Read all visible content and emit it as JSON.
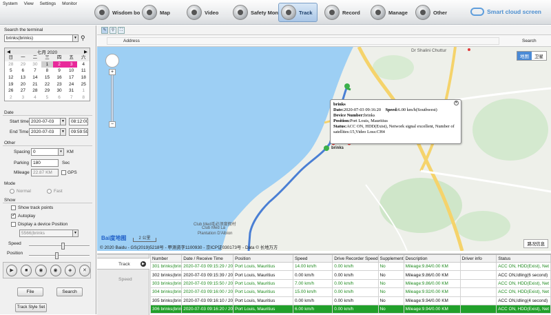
{
  "menu": [
    "System",
    "View",
    "Settings",
    "Monitor"
  ],
  "nav": [
    {
      "label": "Wisdom bo",
      "icon": "dashboard-icon"
    },
    {
      "label": "Map",
      "icon": "map-icon"
    },
    {
      "label": "Video",
      "icon": "video-icon"
    },
    {
      "label": "Safety Mon",
      "icon": "safety-icon"
    },
    {
      "label": "Track",
      "icon": "track-icon",
      "active": true
    },
    {
      "label": "Record",
      "icon": "record-icon"
    },
    {
      "label": "Manage",
      "icon": "manage-icon"
    },
    {
      "label": "Other",
      "icon": "other-icon"
    }
  ],
  "brand": "Smart cloud screen",
  "left": {
    "search_label": "Search the terminal",
    "terminal": "brinks(brinks)",
    "calendar": {
      "month": "七月 2020",
      "weekdays": [
        "日",
        "一",
        "二",
        "三",
        "四",
        "五",
        "六"
      ],
      "days": [
        [
          "28",
          "29",
          "30",
          "1",
          "2",
          "3",
          "4"
        ],
        [
          "5",
          "6",
          "7",
          "8",
          "9",
          "10",
          "11"
        ],
        [
          "12",
          "13",
          "14",
          "15",
          "16",
          "17",
          "18"
        ],
        [
          "19",
          "20",
          "21",
          "22",
          "23",
          "24",
          "25"
        ],
        [
          "26",
          "27",
          "28",
          "29",
          "30",
          "31",
          "1"
        ],
        [
          "2",
          "3",
          "4",
          "5",
          "6",
          "7",
          "8"
        ]
      ]
    },
    "date_label": "Date",
    "start_time_label": "Start time",
    "start_date": "2020-07-03",
    "start_time": "08:12:00",
    "end_time_label": "End Time",
    "end_date": "2020-07-03",
    "end_time": "09:59:59",
    "other_label": "Other",
    "spacing_label": "Spacing",
    "spacing_value": "0",
    "spacing_unit": "KM",
    "parking_label": "Parking",
    "parking_value": "180",
    "parking_unit": "Sec",
    "mileage_label": "Mileage",
    "mileage_value": "22.87 KM",
    "gps_label": "GPS",
    "mode_label": "Mode",
    "mode_normal": "Normal",
    "mode_fast": "Fast",
    "show_label": "Show",
    "show_track_points": "Show track points",
    "autoplay": "Autoplay",
    "display_device": "Display a device Position",
    "device_select": "5566(brinks",
    "speed_label": "Speed",
    "position_label": "Position",
    "file_btn": "File",
    "search_btn": "Search",
    "track_style_btn": "Track Style Set"
  },
  "map": {
    "address_label": "Address",
    "search_btn": "Search",
    "type_map": "地图",
    "type_sat": "卫星",
    "place_label": "Dr Shalini Chuttur",
    "resort_label_cn": "Club Med毛必须度假村",
    "resort_label_1": "Club Med La",
    "resort_label_2": "Plantation D'Albion",
    "marker_label": "brinks",
    "scale_label": "2 公里",
    "copyright": "© 2020 Baidu - GS(2019)5218号 - 甲测资字1100930 - 京ICP证030173号 - Data © 长地万方",
    "road_info": "路况信息",
    "popup": {
      "title": "brinks",
      "date_label": "Date:",
      "date": "2020-07-03 09:16:20",
      "speed_label": "Speed:",
      "speed": "6.00 km/h(Southwest)",
      "device_label": "Device Number:",
      "device": "brinks",
      "position_label": "Position:",
      "position": "Port Louis, Mauritius",
      "status_label": "Status:",
      "status": "ACC ON, HDD(Exist), Network signal excellent, Number of satellites:15,Video Loss:CH4"
    }
  },
  "bottom": {
    "tab_track": "Track",
    "tab_speed": "Speed",
    "columns": [
      "Number",
      "Date / Receive Time",
      "Position",
      "Speed",
      "Drive Recorder Speed",
      "Supplement",
      "Description",
      "Driver info",
      "Status"
    ],
    "rows": [
      {
        "cells": [
          "301 brinks(brin",
          "2020-07-03 09:15:29 / 20",
          "Port Louis, Mauritius",
          "14.00 km/h",
          "0.00 km/h",
          "No",
          "Mileage:9.84/0.00 KM",
          "",
          "ACC ON, HDD(Exist), Net"
        ],
        "style": "green"
      },
      {
        "cells": [
          "302 brinks(brin",
          "2020-07-03 09:15:39 / 20",
          "Port Louis, Mauritius",
          "0.00 km/h",
          "0.00 km/h",
          "No",
          "Mileage:9.86/0.00 KM",
          "",
          "ACC ON,Idling(6 second)"
        ],
        "style": "black"
      },
      {
        "cells": [
          "303 brinks(brin",
          "2020-07-03 09:15:50 / 20",
          "Port Louis, Mauritius",
          "7.00 km/h",
          "0.00 km/h",
          "No",
          "Mileage:9.86/0.00 KM",
          "",
          "ACC ON, HDD(Exist), Net"
        ],
        "style": "green"
      },
      {
        "cells": [
          "304 brinks(brin",
          "2020-07-03 09:16:00 / 20",
          "Port Louis, Mauritius",
          "15.00 km/h",
          "0.00 km/h",
          "No",
          "Mileage:9.92/0.00 KM",
          "",
          "ACC ON, HDD(Exist), Net"
        ],
        "style": "green"
      },
      {
        "cells": [
          "305 brinks(brin",
          "2020-07-03 09:16:10 / 20",
          "Port Louis, Mauritius",
          "0.00 km/h",
          "0.00 km/h",
          "No",
          "Mileage:9.94/0.00 KM",
          "",
          "ACC ON,Idling(4 second)"
        ],
        "style": "black"
      },
      {
        "cells": [
          "306 brinks(brin",
          "2020-07-03 09:16:20 / 20",
          "Port Louis, Mauritius",
          "6.00 km/h",
          "0.00 km/h",
          "No",
          "Mileage:9.94/0.00 KM",
          "",
          "ACC ON, HDD(Exist), Net"
        ],
        "style": "selected"
      }
    ]
  }
}
